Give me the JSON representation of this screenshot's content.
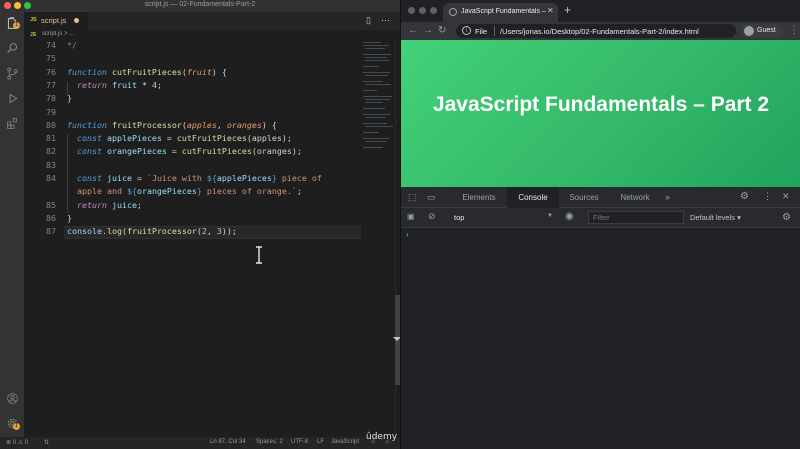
{
  "vscode": {
    "window_title": "script.js — 02-Fundamentals-Part-2",
    "tab": {
      "label": "script.js",
      "icon": "JS",
      "modified": true
    },
    "breadcrumb": {
      "icon": "JS",
      "text": "script.js > ..."
    },
    "code_lines": [
      {
        "num": "74",
        "tokens": [
          {
            "t": "*/",
            "c": "cm"
          }
        ]
      },
      {
        "num": "75",
        "tokens": []
      },
      {
        "num": "76",
        "tokens": [
          {
            "t": "function",
            "c": "sk"
          },
          {
            "t": " ",
            "c": "op"
          },
          {
            "t": "cutFruitPieces",
            "c": "fn"
          },
          {
            "t": "(",
            "c": "op"
          },
          {
            "t": "fruit",
            "c": "pm"
          },
          {
            "t": ") {",
            "c": "op"
          }
        ]
      },
      {
        "num": "77",
        "tokens": [
          {
            "t": "  ",
            "c": "op"
          },
          {
            "t": "return",
            "c": "kw"
          },
          {
            "t": " fruit ",
            "c": "vr"
          },
          {
            "t": "* ",
            "c": "op"
          },
          {
            "t": "4",
            "c": "nm"
          },
          {
            "t": ";",
            "c": "op"
          }
        ]
      },
      {
        "num": "78",
        "tokens": [
          {
            "t": "}",
            "c": "op"
          }
        ]
      },
      {
        "num": "79",
        "tokens": []
      },
      {
        "num": "80",
        "tokens": [
          {
            "t": "function",
            "c": "sk"
          },
          {
            "t": " ",
            "c": "op"
          },
          {
            "t": "fruitProcessor",
            "c": "fn"
          },
          {
            "t": "(",
            "c": "op"
          },
          {
            "t": "apples",
            "c": "pm"
          },
          {
            "t": ", ",
            "c": "op"
          },
          {
            "t": "oranges",
            "c": "pm"
          },
          {
            "t": ") {",
            "c": "op"
          }
        ]
      },
      {
        "num": "81",
        "tokens": [
          {
            "t": "  ",
            "c": "op"
          },
          {
            "t": "const",
            "c": "sk"
          },
          {
            "t": " applePieces ",
            "c": "vr"
          },
          {
            "t": "= ",
            "c": "op"
          },
          {
            "t": "cutFruitPieces",
            "c": "fn"
          },
          {
            "t": "(apples);",
            "c": "op"
          }
        ]
      },
      {
        "num": "82",
        "tokens": [
          {
            "t": "  ",
            "c": "op"
          },
          {
            "t": "const",
            "c": "sk"
          },
          {
            "t": " orangePieces ",
            "c": "vr"
          },
          {
            "t": "= ",
            "c": "op"
          },
          {
            "t": "cutFruitPieces",
            "c": "fn"
          },
          {
            "t": "(oranges);",
            "c": "op"
          }
        ]
      },
      {
        "num": "83",
        "tokens": []
      },
      {
        "num": "84",
        "tokens": [
          {
            "t": "  ",
            "c": "op"
          },
          {
            "t": "const",
            "c": "sk"
          },
          {
            "t": " juice ",
            "c": "vr"
          },
          {
            "t": "= ",
            "c": "op"
          },
          {
            "t": "`Juice with ",
            "c": "st"
          },
          {
            "t": "${",
            "c": "tp"
          },
          {
            "t": "applePieces",
            "c": "vr"
          },
          {
            "t": "}",
            "c": "tp"
          },
          {
            "t": " piece of",
            "c": "st"
          }
        ]
      },
      {
        "num": "",
        "tokens": [
          {
            "t": "  apple and ",
            "c": "st"
          },
          {
            "t": "${",
            "c": "tp"
          },
          {
            "t": "orangePieces",
            "c": "vr"
          },
          {
            "t": "}",
            "c": "tp"
          },
          {
            "t": " pieces of orange.`",
            "c": "st"
          },
          {
            "t": ";",
            "c": "op"
          }
        ]
      },
      {
        "num": "85",
        "tokens": [
          {
            "t": "  ",
            "c": "op"
          },
          {
            "t": "return",
            "c": "kw"
          },
          {
            "t": " juice",
            "c": "vr"
          },
          {
            "t": ";",
            "c": "op"
          }
        ]
      },
      {
        "num": "86",
        "tokens": [
          {
            "t": "}",
            "c": "op"
          }
        ]
      },
      {
        "num": "87",
        "tokens": [
          {
            "t": "console",
            "c": "vr"
          },
          {
            "t": ".",
            "c": "op"
          },
          {
            "t": "log",
            "c": "fn"
          },
          {
            "t": "(",
            "c": "op"
          },
          {
            "t": "fruitProcessor",
            "c": "fn"
          },
          {
            "t": "(",
            "c": "op"
          },
          {
            "t": "2",
            "c": "nm"
          },
          {
            "t": ", ",
            "c": "op"
          },
          {
            "t": "3",
            "c": "nm"
          },
          {
            "t": "));",
            "c": "op"
          }
        ]
      }
    ],
    "status": {
      "problems": "⊗ 0  ⚠ 0",
      "cursor": "Ln 87, Col 34",
      "spaces": "Spaces: 2",
      "encoding": "UTF-8",
      "eol": "LF",
      "language": "JavaScript"
    }
  },
  "chrome": {
    "tab_title": "JavaScript Fundamentals – Pa",
    "address_scheme": "File",
    "address_url": "/Users/jonas.io/Desktop/02-Fundamentals-Part-2/index.html",
    "profile": "Guest",
    "page_heading": "JavaScript Fundamentals – Part 2",
    "devtools": {
      "tabs": [
        "Elements",
        "Console",
        "Sources",
        "Network"
      ],
      "active_tab": "Console",
      "context": "top",
      "filter_placeholder": "Filter",
      "levels": "Default levels ▾",
      "prompt": "›"
    }
  },
  "watermark": "ûdemy",
  "colors": {
    "page_gradient_start": "#43d17a",
    "page_gradient_end": "#20a45e",
    "editor_bg": "#1e1e1e",
    "devtools_bg": "#202124"
  }
}
